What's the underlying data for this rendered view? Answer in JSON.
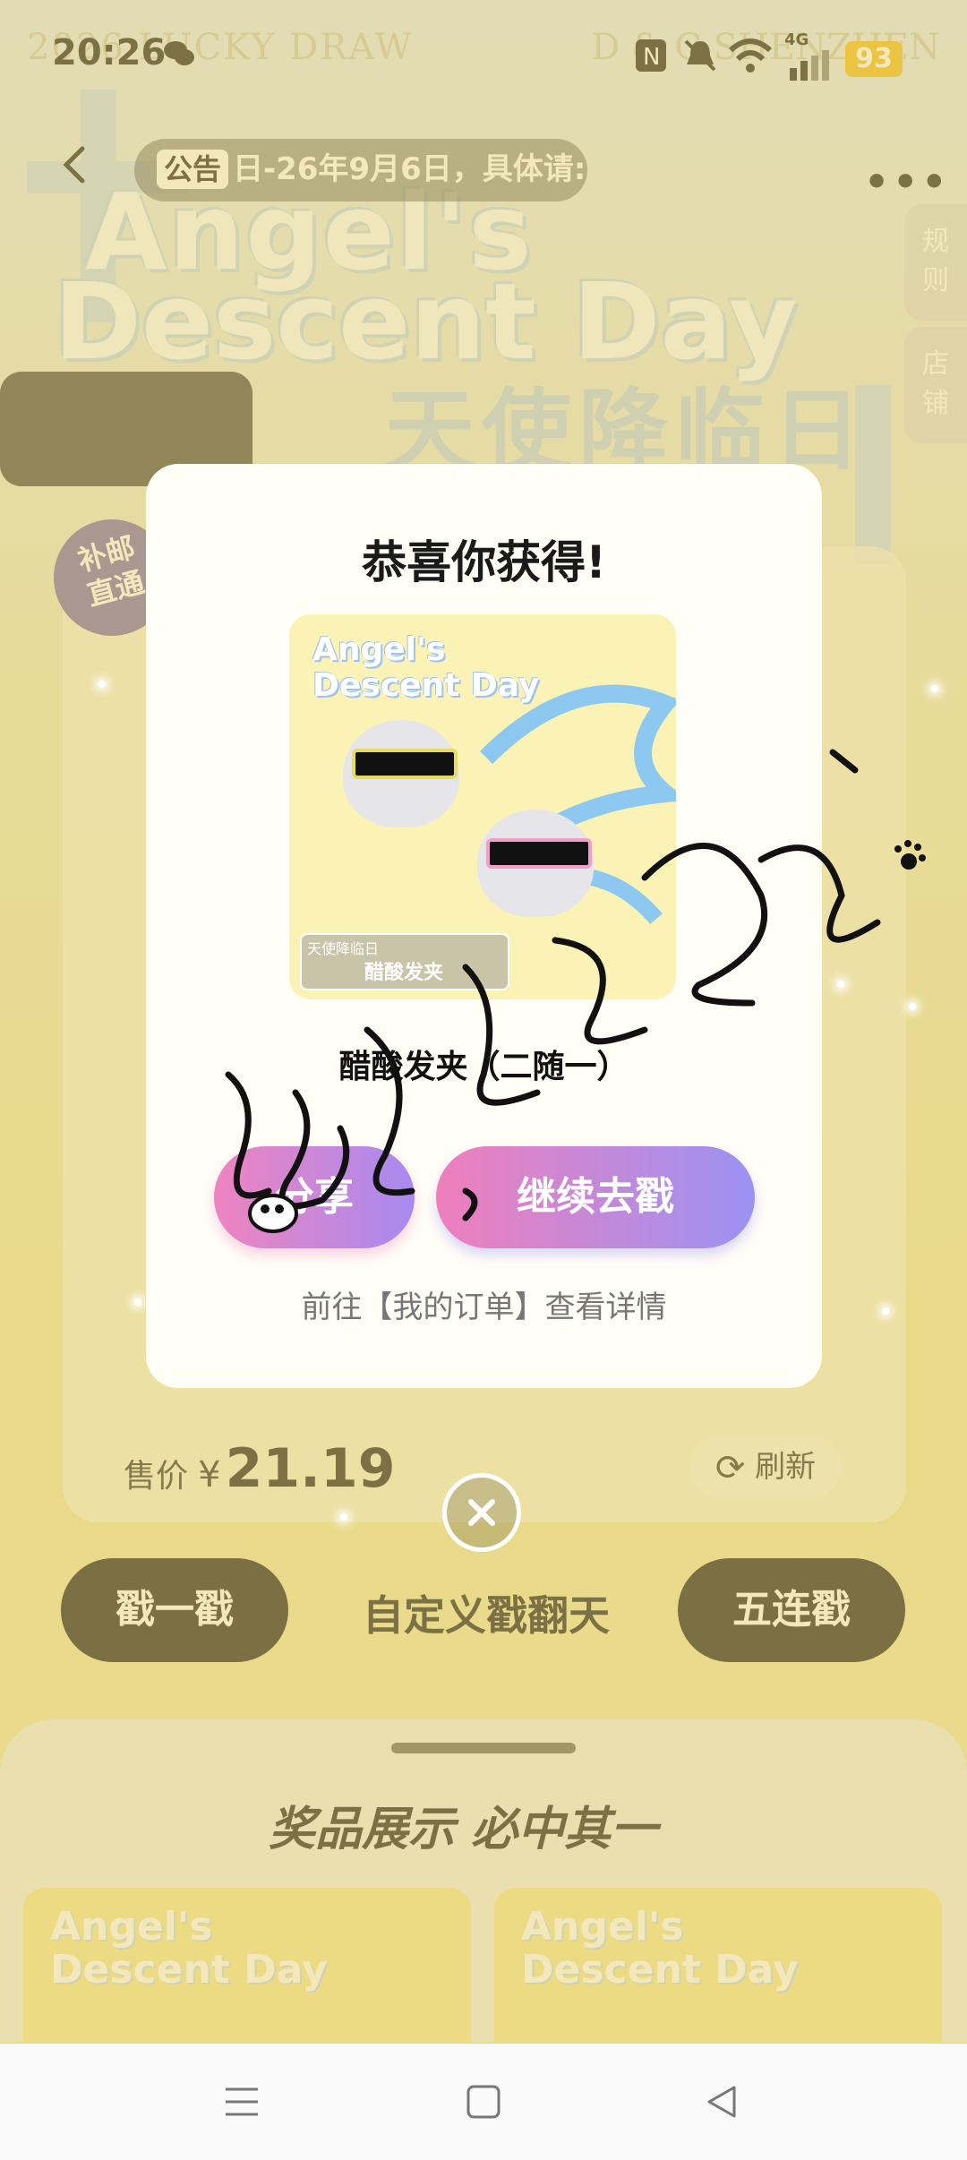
{
  "watermark": {
    "left": "2026 LUCKY DRAW",
    "right": "D & C SHENZHEN"
  },
  "status_bar": {
    "time": "20:26",
    "battery": "93",
    "network": "4G"
  },
  "header": {
    "notice_tag": "公告",
    "notice_text": "日-26年9月6日，具体请:",
    "side_tabs": [
      {
        "label_1": "规",
        "label_2": "则"
      },
      {
        "label_1": "店",
        "label_2": "铺"
      }
    ]
  },
  "banner": {
    "title_line1": "Angel's",
    "title_line2": "Descent Day",
    "title_cn": "天使降临日"
  },
  "stamp": {
    "line1": "补邮",
    "line2": "直通"
  },
  "main": {
    "price_label": "售价",
    "currency": "¥",
    "price": "21.19",
    "refresh_label": "刷新",
    "single_draw_label": "戳一戳",
    "custom_label": "自定义戳翻天",
    "five_draw_label": "五连戳"
  },
  "prize_sheet": {
    "title": "奖品展示 必中其一",
    "cards": [
      {
        "logo1": "Angel's",
        "logo2": "Descent Day"
      },
      {
        "logo1": "Angel's",
        "logo2": "Descent Day"
      }
    ]
  },
  "modal": {
    "title": "恭喜你获得!",
    "prize_image": {
      "logo1": "Angel's",
      "logo2": "Descent Day",
      "tag_small": "天使降临日",
      "tag_main": "醋酸发夹"
    },
    "prize_name": "醋酸发夹（二随一）",
    "share_label": "分享",
    "continue_label": "继续去戳",
    "order_link": "前往【我的订单】查看详情"
  },
  "icons": {
    "back": "chevron-left-icon",
    "more": "more-dots-icon",
    "refresh": "refresh-icon",
    "close": "close-icon",
    "nav_menu": "menu-icon",
    "nav_home": "home-square-icon",
    "nav_back": "back-triangle-icon"
  },
  "colors": {
    "accent_pink": "#ee84bf",
    "accent_purple": "#9b92f3",
    "battery": "#f0b90c"
  }
}
